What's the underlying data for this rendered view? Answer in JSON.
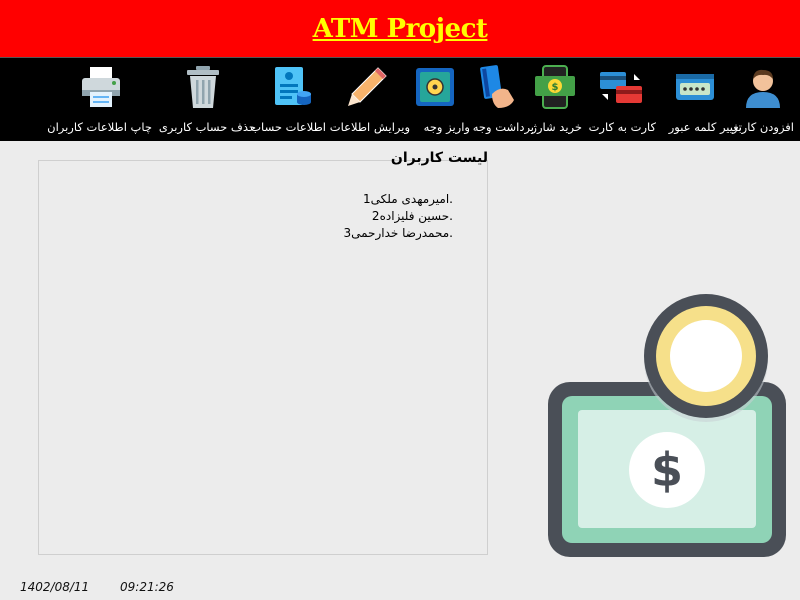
{
  "app": {
    "title": "ATM Project"
  },
  "toolbar": {
    "items": [
      {
        "label": "افزودن کاربر",
        "icon": "user-icon"
      },
      {
        "label": "تغییر کلمه عبور",
        "icon": "password-field-icon"
      },
      {
        "label": "کارت به کارت",
        "icon": "card-transfer-icon"
      },
      {
        "label": "خرید شارژ",
        "icon": "mobile-cash-icon"
      },
      {
        "label": "برداشت وجه",
        "icon": "card-in-hand-icon"
      },
      {
        "label": "واریز وجه",
        "icon": "safe-icon"
      },
      {
        "label": "ویرایش اطلاعات",
        "icon": "pencil-icon"
      },
      {
        "label": "اطلاعات حساب",
        "icon": "account-info-icon"
      },
      {
        "label": "حذف حساب کاربری",
        "icon": "trash-icon"
      },
      {
        "label": "چاپ اطلاعات کاربران",
        "icon": "printer-icon"
      }
    ]
  },
  "users_panel": {
    "title": "لیست کاربران",
    "users": [
      {
        "num": "1.",
        "name": "امیرمهدی ملکی"
      },
      {
        "num": "2.",
        "name": "حسین فلیزاده"
      },
      {
        "num": "3.",
        "name": "محمدرضا خدارحمی"
      }
    ]
  },
  "status_bar": {
    "date": "1402/08/11",
    "time": "09:21:26"
  },
  "illustration": {
    "icon": "money-coin-icon"
  },
  "colors": {
    "title_bar": "#ff0000",
    "title_text": "#ffff00",
    "toolbar_bg": "#000000",
    "window_bg": "#ececec",
    "bill_green": "#8fd3b6",
    "coin_yellow": "#f6e08a",
    "outline_dark": "#4a4f57"
  }
}
